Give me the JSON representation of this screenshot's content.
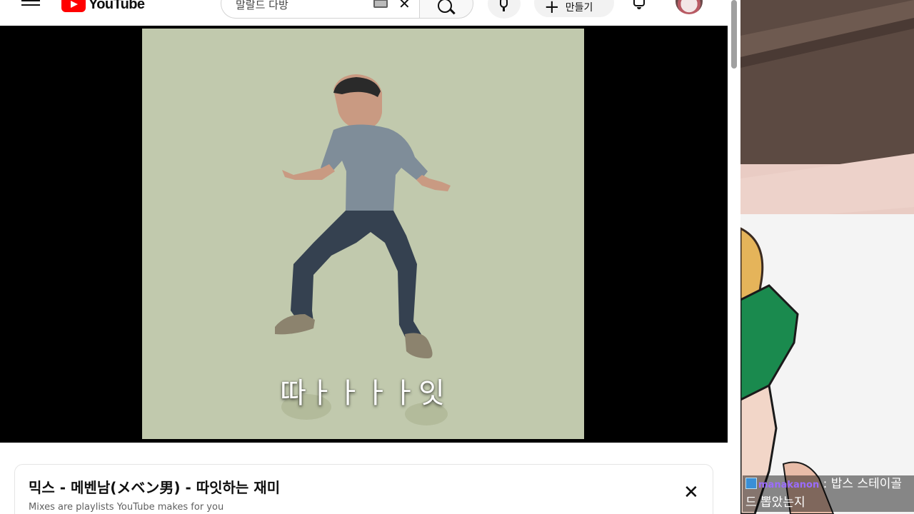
{
  "header": {
    "logo_text": "YouTube",
    "search_value": "말랄드 다방",
    "create_label": "만들기"
  },
  "video": {
    "subtitle": "따ㅏㅏㅏㅏ잇"
  },
  "playlist_panel": {
    "title": "믹스 - 메벤남(メベン男) - 따잇하는 재미",
    "subtitle": "Mixes are playlists YouTube makes for you"
  },
  "chat_overlay": {
    "username": "manakanon",
    "separator": " : ",
    "message": "밥스 스테이골드 뽑았는지"
  },
  "colors": {
    "youtube_red": "#ff0000",
    "video_background": "#c1c9ad",
    "player_background": "#000000",
    "chat_username": "#9b6cff"
  }
}
